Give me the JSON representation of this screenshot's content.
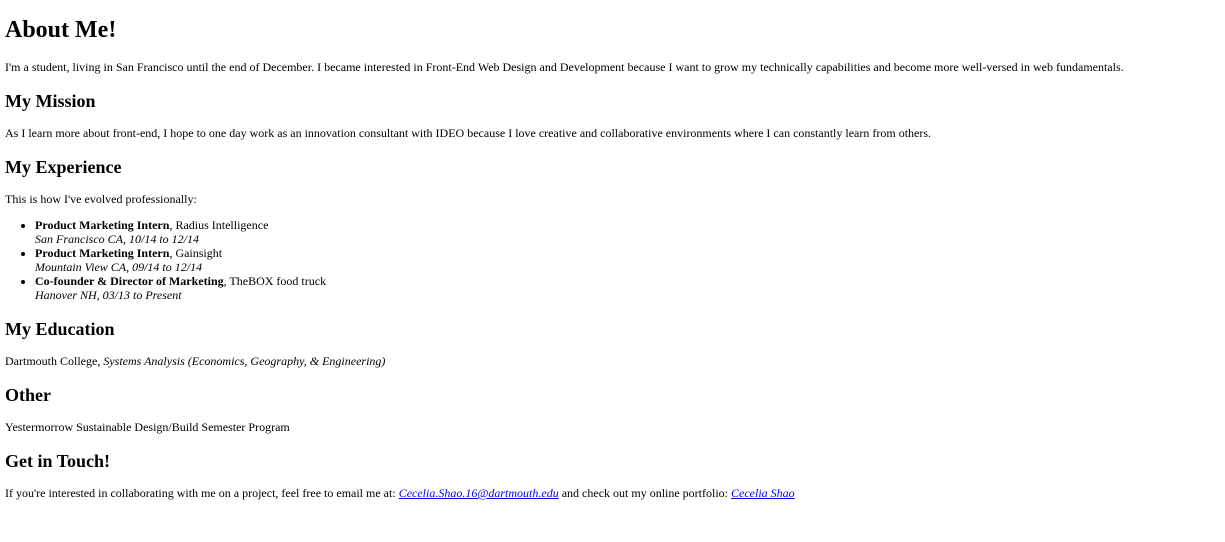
{
  "heading": "About Me!",
  "intro": "I'm a student, living in San Francisco until the end of December. I became interested in Front-End Web Design and Development because I want to grow my technically capabilities and become more well-versed in web fundamentals.",
  "mission": {
    "heading": "My Mission",
    "text": "As I learn more about front-end, I hope to one day work as an innovation consultant with IDEO because I love creative and collaborative environments where I can constantly learn from others."
  },
  "experience": {
    "heading": "My Experience",
    "intro": "This is how I've evolved professionally:",
    "items": [
      {
        "role": "Product Marketing Intern",
        "company": ", Radius Intelligence",
        "details": "San Francisco CA, 10/14 to 12/14"
      },
      {
        "role": "Product Marketing Intern",
        "company": ", Gainsight",
        "details": "Mountain View CA, 09/14 to 12/14"
      },
      {
        "role": "Co-founder & Director of Marketing",
        "company": ", TheBOX food truck",
        "details": "Hanover NH, 03/13 to Present"
      }
    ]
  },
  "education": {
    "heading": "My Education",
    "school": "Dartmouth College, ",
    "major": "Systems Analysis (Economics, Geography, & Engineering)"
  },
  "other": {
    "heading": "Other",
    "text": "Yestermorrow Sustainable Design/Build Semester Program"
  },
  "contact": {
    "heading": "Get in Touch!",
    "text_before": "If you're interested in collaborating with me on a project, feel free to email me at: ",
    "email": "Cecelia.Shao.16@dartmouth.edu",
    "text_middle": " and check out my online portfolio: ",
    "portfolio": "Cecelia Shao"
  }
}
